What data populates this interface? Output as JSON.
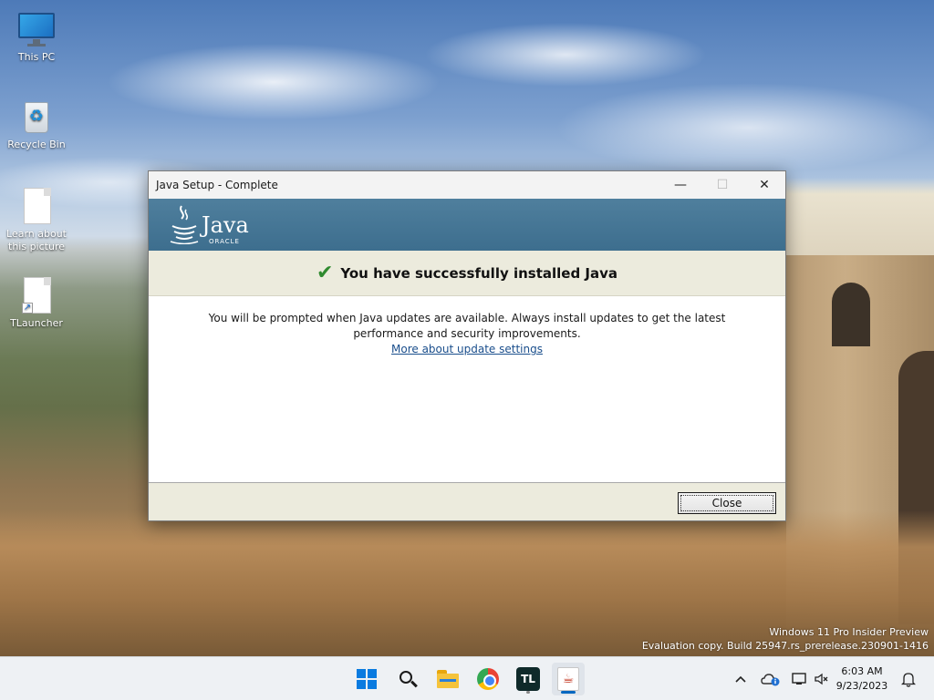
{
  "desktop": {
    "icons": [
      {
        "label": "This PC",
        "icon": "monitor-icon"
      },
      {
        "label": "Recycle Bin",
        "icon": "recycle-bin-icon"
      },
      {
        "label": "Learn about this picture",
        "icon": "document-icon"
      },
      {
        "label": "TLauncher",
        "icon": "shortcut-document-icon"
      }
    ],
    "watermark": {
      "line1": "Windows 11 Pro Insider Preview",
      "line2": "Evaluation copy. Build 25947.rs_prerelease.230901-1416"
    }
  },
  "dialog": {
    "title": "Java Setup - Complete",
    "controls": {
      "minimize": "—",
      "maximize": "☐",
      "close": "✕"
    },
    "logo": {
      "word": "Java",
      "sub": "ORACLE"
    },
    "status": "You have successfully installed Java",
    "message": "You will be prompted when Java updates are available. Always install updates to get the latest performance and security improvements.",
    "link": "More about update settings",
    "close_label": "Close"
  },
  "taskbar": {
    "apps": [
      {
        "name": "start",
        "icon": "windows-start-icon"
      },
      {
        "name": "search",
        "icon": "search-icon"
      },
      {
        "name": "file-explorer",
        "icon": "folder-icon"
      },
      {
        "name": "chrome",
        "icon": "chrome-icon"
      },
      {
        "name": "tlauncher",
        "icon": "tlauncher-icon",
        "text": "TL"
      },
      {
        "name": "java-setup",
        "icon": "java-icon"
      }
    ],
    "clock": {
      "time": "6:03 AM",
      "date": "9/23/2023"
    }
  },
  "colors": {
    "banner": "#3d6e8e",
    "status_strip": "#ecebdd",
    "check": "#2f8a2f",
    "link": "#1a4e8c",
    "taskbar": "#eef1f4",
    "accent": "#0067c0"
  }
}
